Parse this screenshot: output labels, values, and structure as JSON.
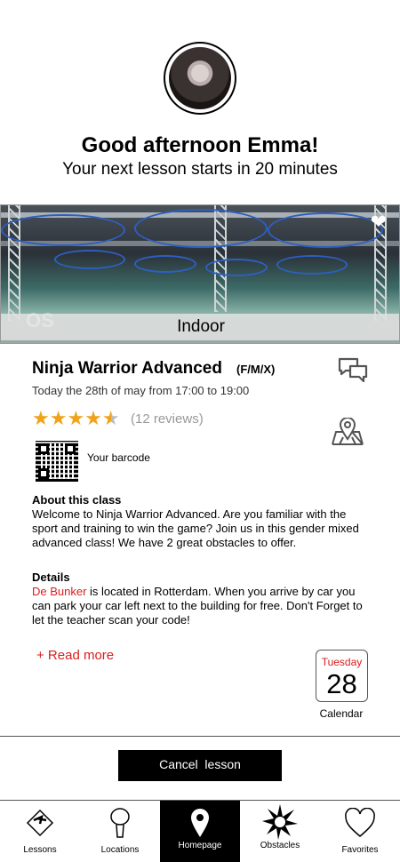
{
  "header": {
    "greeting": "Good afternoon Emma!",
    "next_lesson": "Your next lesson starts in 20 minutes"
  },
  "hero": {
    "location_type": "Indoor",
    "logo_text": "OS"
  },
  "lesson": {
    "title": "Ninja Warrior Advanced",
    "gender": "(F/M/X)",
    "time": "Today the 28th of may from 17:00 to 19:00",
    "rating": 4.5,
    "stars": "★★★★",
    "half_star": "★",
    "reviews": "(12 reviews)"
  },
  "barcode": {
    "label": "Your barcode"
  },
  "about": {
    "heading": "About this class",
    "text": "Welcome to Ninja Warrior Advanced. Are you familiar with the sport and training to win the game? Join us in this gender mixed advanced class! We have 2 great obstacles to offer."
  },
  "details": {
    "heading": "Details",
    "venue": "De Bunker",
    "text": " is located in Rotterdam. When you arrive by car you can park your car left next to the building for free. Don't Forget to let the teacher scan your code!"
  },
  "read_more": "+ Read more",
  "calendar": {
    "day": "Tuesday",
    "date": "28",
    "label": "Calendar"
  },
  "cancel_button": "Cancel  lesson",
  "tabs": [
    {
      "label": "Lessons",
      "icon": "lessons-icon",
      "active": false
    },
    {
      "label": "Locations",
      "icon": "locations-icon",
      "active": false
    },
    {
      "label": "Homepage",
      "icon": "location-pin-icon",
      "active": true
    },
    {
      "label": "Obstacles",
      "icon": "obstacles-icon",
      "active": false
    },
    {
      "label": "Favorites",
      "icon": "heart-icon",
      "active": false
    }
  ],
  "colors": {
    "accent_red": "#d71e1e",
    "star": "#f1a21b"
  }
}
